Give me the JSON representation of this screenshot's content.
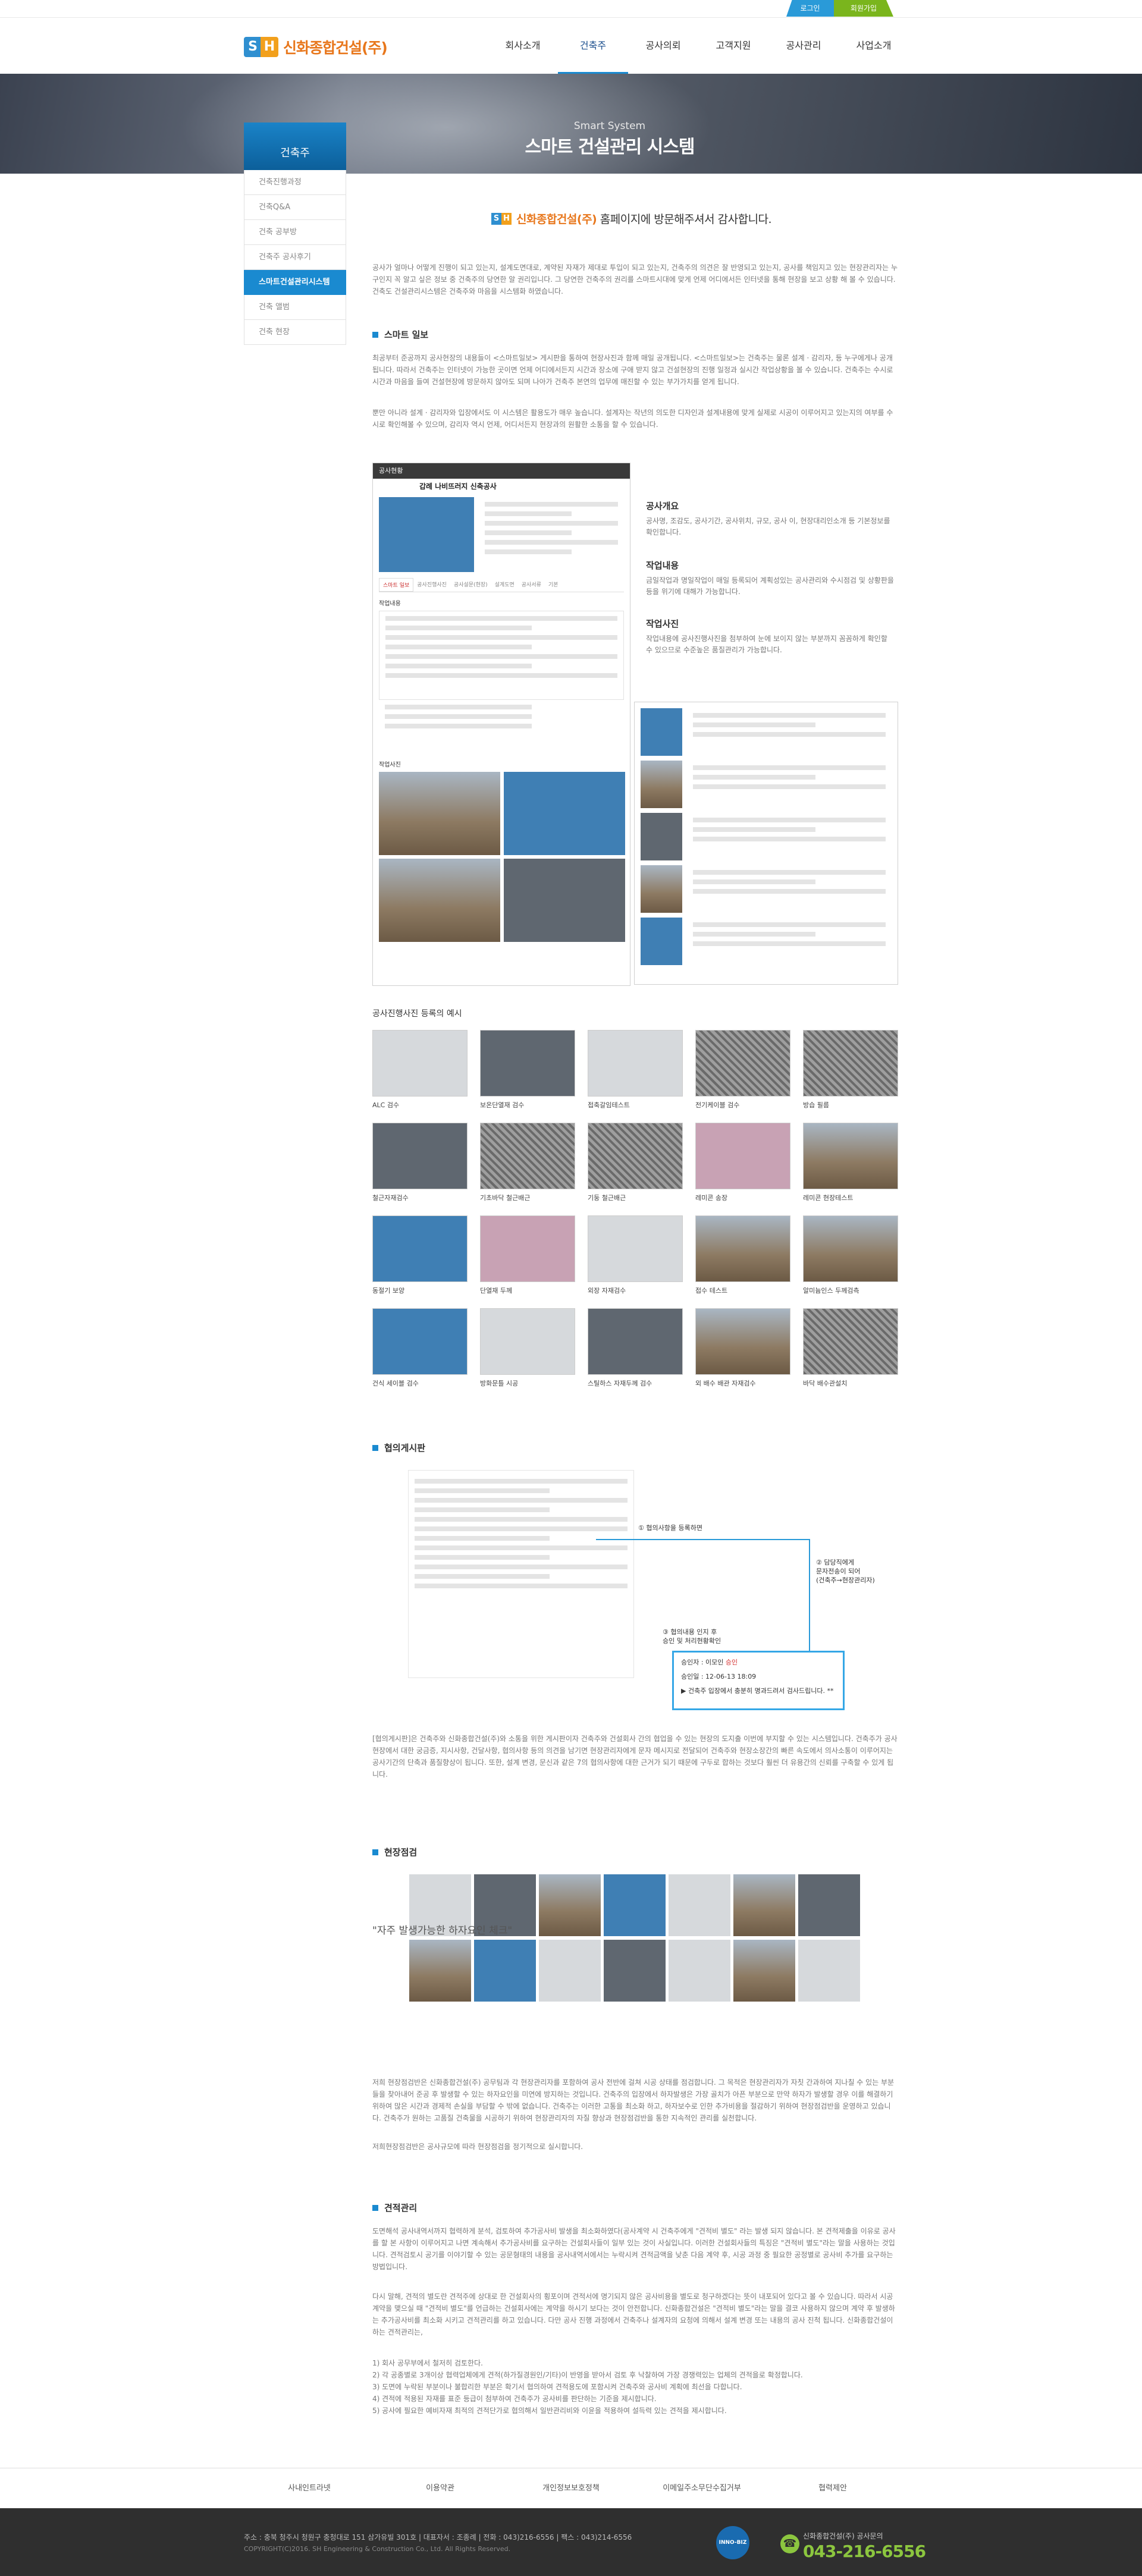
{
  "top_buttons": {
    "login": "로그인",
    "join": "회원가입"
  },
  "logo": {
    "mark_s": "S",
    "mark_h": "H",
    "text": "신화종합건설(주)"
  },
  "nav": [
    "회사소개",
    "건축주",
    "공사의뢰",
    "고객지원",
    "공사관리",
    "사업소개"
  ],
  "visual": {
    "sub": "Smart System",
    "title": "스마트 건설관리 시스템"
  },
  "sidebar": {
    "title": "건축주",
    "items": [
      "건축진행과정",
      "건축Q&A",
      "건축 공부방",
      "건축주 공사후기",
      "스마트건설관리시스템",
      "건축 앨범",
      "건축 현장"
    ]
  },
  "greeting": {
    "company": "신화종합건설(주)",
    "text": " 홈페이지에 방문해주셔서 감사합니다."
  },
  "intro": "공사가 얼마나 어떻게 진행이 되고 있는지, 설계도면대로, 계약된 자재가 제대로 투입이 되고 있는지, 건축주의 의견은 잘 반영되고 있는지, 공사를 책임지고 있는 현장관리자는 누구인지 꼭 알고 싶은 정보 중 건축주의 당연한 알 권리입니다. 그 당연한 건축주의 권리를 스마트시대에 맞게 언제 어디에서든 인터넷을 통해 현장을 보고 상황 해 볼 수 있습니다. 건축도 건설관리시스템은 건축주와 마음을 시스템화 하였습니다.",
  "section_ilbo": {
    "title": "스마트 일보",
    "p1": "최공부터 준공까지 공사현장의 내용들이 <스마트일보> 게시판을 통하여 현장사진과 함께 매일 공개됩니다. <스마트일보>는 건축주는 물론 설계 · 감리자, 등 누구에게나 공개됩니다. 따라서 건축주는 인터넷이 가능한 곳이면 언제 어디에서든지 시간과 장소에 구애 받지 않고 건설현장의 진행 일정과 실시간 작업상황을 볼 수 있습니다. 건축주는 수시로 시간과 마음을 들여 건설현장에 방문하지 않아도 되며 나아가 건축주 본연의 업무에 매진할 수 있는 부가가치를 얻게 됩니다.",
    "p2": "뿐만 아니라 설계 · 감리자와 입장에서도 이 시스템은 활용도가 매우 높습니다. 설계자는 작년의 의도한 디자인과 설계내용에 맞게 실제로 시공이 이루어지고 있는지의 여부를 수시로 확인해볼 수 있으며, 감리자 역시 언제, 어디서든지 현장과의 원활한 소통을 할 수 있습니다."
  },
  "mock_report": {
    "header": "공사현황",
    "title": "갑례 나비뜨러지 신축공사",
    "tabs": [
      "스마트 일보",
      "공사진행사진",
      "공사설문(현장)",
      "설계도면",
      "공사서류",
      "기본"
    ],
    "section_content": "작업내용",
    "section_photo": "작업사진"
  },
  "side_info": [
    {
      "title": "공사개요",
      "text": "공사명, 조감도, 공사기간, 공사위치, 규모, 공사 이, 현장대리인소개 등 기본정보를 확인합니다."
    },
    {
      "title": "작업내용",
      "text": "금일작업과 명일작업이 매일 등록되어 계획성있는 공사관리와 수시점검 및 상황판을 등을 위기에 대해가 가능합니다."
    },
    {
      "title": "작업사진",
      "text": "작업내용에 공사진행사진을 첨부하여 눈에 보이지 않는 부분까지 꼼꼼하게 확인할 수 있으므로 수준높은 품질관리가 가능합니다."
    }
  ],
  "photo_section_title": "공사진행사진 등록의 예시",
  "photos": [
    {
      "cap": "ALC 검수",
      "tone": "light"
    },
    {
      "cap": "보온단열재 검수",
      "tone": "dark"
    },
    {
      "cap": "접축갈임테스트",
      "tone": "light"
    },
    {
      "cap": "전기케이블 검수",
      "tone": "rebar"
    },
    {
      "cap": "방습 필름",
      "tone": "rebar"
    },
    {
      "cap": "철근자재검수",
      "tone": "dark"
    },
    {
      "cap": "기초바닥 철근배근",
      "tone": "rebar"
    },
    {
      "cap": "기둥 철근배근",
      "tone": "rebar"
    },
    {
      "cap": "레미콘 송장",
      "tone": "pink"
    },
    {
      "cap": "레미콘 현장테스트",
      "tone": "site"
    },
    {
      "cap": "동절기 보양",
      "tone": "blue"
    },
    {
      "cap": "단열재 두께",
      "tone": "pink"
    },
    {
      "cap": "외장 자재검수",
      "tone": "light"
    },
    {
      "cap": "접수 테스트",
      "tone": "site"
    },
    {
      "cap": "알미늄인스 두께검측",
      "tone": "site"
    },
    {
      "cap": "건식 세이블 검수",
      "tone": "blue"
    },
    {
      "cap": "방화문틀 시공",
      "tone": "light"
    },
    {
      "cap": "스틸하스 자재두께 검수",
      "tone": "dark"
    },
    {
      "cap": "외 배수 배관 자재검수",
      "tone": "site"
    },
    {
      "cap": "바닥 배수관설치",
      "tone": "rebar"
    }
  ],
  "consult": {
    "title": "협의게시판",
    "step1": "① 협의사항을 등록하면",
    "step2_a": "② 담당직에게",
    "step2_b": "문자전송이 되어",
    "step2_c": "(건축주→현장관리자)",
    "step3_a": "③ 협의내용 인지 후",
    "step3_b": "승인 및 처리현황확인",
    "box_row1_label": "승인자 : 이모인 ",
    "box_row1_red": "승인",
    "box_row2": "승인일 : 12-06-13 18:09",
    "box_row3": "▶ 건축주 입장에서 충분히 명과드려서 검사드립니다. **",
    "paragraph": "[협의게시판]은 건축주와 신화종합건설(주)와 소통을 위한 게시판이자 건축주와 건설회사 간의 협업을 수 있는 현장의 도지출 이번에 부지할 수 있는 시스템입니다. 건축주가 공사현장에서 대한 궁금증, 지시사항, 건달사항, 협의사항 등의 의견을 남기면 현장관리자에게 문자 메시지로 전달되어 건축주와 현장소장간의 빠른 속도에서 의사소통이 이루어지는 공사기간의 단축과 품질향상이 됩니다. 또한, 설계 변경, 문신과 같은 7의 협의사항에 대한 근거가 되기 때문에 구두로 합하는 것보다 훨씬 더 유용간의 신뢰를 구축할 수 있게 됩니다."
  },
  "inspect": {
    "title": "현장점검",
    "quote": "\"자주 발생가능한 하자요인 체크\"",
    "p1": "저희 현장점검반은 신화종합건설(주) 공무팀과 각 현장관리자를 포함하여 공사 전반에 걸쳐 시공 상태를 점검합니다. 그 목적은 현장관리자가 자칫 간과하여 지나칠 수 있는 부분들을 찾아내어 준공 후 발생할 수 있는 하자요인을 미연에 방지하는 것입니다. 건축주의 입장에서 하자발생은 가장 골치가 아픈 부분으로 만약 하자가 발생할 경우 이를 해결하기 위하여 많은 시간과 경제적 손실을 부담할 수 밖에 없습니다. 건축주는 이러한 고통을 최소화 하고, 하자보수로 인한 추가비용을 절감하기 위하여 현장점검반을 운영하고 있습니다. 건축주가 원하는 고품질 건축물을 시공하기 위하여 현장관리자의 자질 향상과 현장점검반을 통한 지속적인 관리를 실천합니다.",
    "p2": "저희현장점검반은 공사규모에 따라 현장점검을 정기적으로 실시합니다."
  },
  "cost": {
    "title": "견적관리",
    "p1": "도면해석 공사내역서까지 협력하게 분석, 검토하여 추가공사비 발생을 최소화하였다(공사계약 시 건축주에게 \"견적비 별도\" 라는 발생 되지 않습니다. 본 견적제출을 이유로 공사를 할 본 사항이 이루어지고 나면 계속해서 추가공사비를 요구하는 건설회사들이 일부 있는 것이 사실입니다. 이러한 건설회사들의 특징은 \"견적비 별도\"라는 말을 사용하는 것입니다. 견적검토시 공기를 이야기할 수 있는 공문형태의 내용을 공사내역서에서는 누락시켜 견적금액을 낮춘 다음 계약 후, 시공 과정 중 필요한 공정별로 공사비 추가를 요구하는 방법입니다.",
    "p2": "다시 말해, 견적의 별도란 견적주에 상대로 한 건설회사의 횡포이며 견적서에 명기되지 않은 공사비용을 별도로 청구하겠다는 뜻이 내포되어 있다고 볼 수 있습니다. 따라서 시공계약을 맺으실 때 \"견적비 별도\"를 언급하는 건설회사에는 계약을 하시기 보다는 것이 안전합니다. 신화종합건설은 \"견적비 별도\"라는 말을 결코 사용하지 않으며 계약 후 발생하는 추가공사비를 최소화 시키고 견적관리를 하고 있습니다. 다만 공사 진행 과정에서 건축주나 설계자의 요청에 의해서 설계 변경 또는 내용의 공사 진척 됩니다. 신화종합건설이 하는 견적관리는,",
    "list": [
      "1) 회사 공무부에서 철저히 검토한다.",
      "2) 각 공종별로 3개이상 협력업체에게 견적(하가질경원인/기타)이 반영을 받아서 검토 후 낙찰하여 가장 경쟁력있는 업체의 견적을로 확정합니다.",
      "3) 도면에 누락된 부분이나 불합리한 부분은 확기서 협의하여 견적용도에 포함시켜 건축주와 공사비 계획에 최선을 다합니다.",
      "4) 견적에 적용된 자재를 표준 등급이 첨부하여 건축주가 공사비를 판단하는 기준을 제시합니다.",
      "5) 공사에 필요한 예비자재 최적의 견적단가로 협의해서 일반관리비와 이윤을 적용하여 설득력 있는 견적을 제시합니다."
    ]
  },
  "footer": {
    "links": [
      "사내인트라넷",
      "이용약관",
      "개인정보보호정책",
      "이메일주소무단수집거부",
      "협력제안"
    ],
    "address": "주소 : 충북 청주시 청원구 충청대로 151 삼가유빌 301호  |  대표자서 : 조종례  |  전화 : 043)216-6556  |  팩스 : 043)214-6556",
    "copyright": "COPYRIGHT(C)2016. SH Engineering & Construction Co., Ltd. All Rights Reserved.",
    "badge": "INNO-BIZ",
    "call_label": "신화종합건설(주) 공사문의",
    "call_number": "043-216-6556"
  }
}
